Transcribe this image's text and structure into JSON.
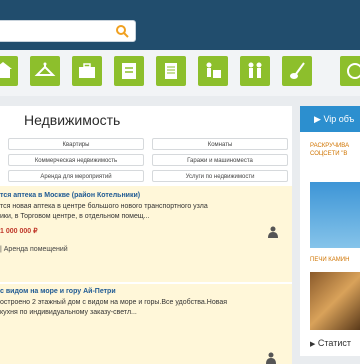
{
  "search": {
    "value": "",
    "placeholder": ""
  },
  "categories": [
    "real-estate",
    "clothing",
    "jobs",
    "services",
    "documents",
    "moving",
    "kids",
    "music",
    "hobbies"
  ],
  "main": {
    "title": "Недвижимость",
    "subcategories": [
      "Квартиры",
      "Комнаты",
      "Коммерческая недвижимость",
      "Гаражи и машиноместа",
      "Аренда для мероприятий",
      "Услуги по недвижимости"
    ],
    "listings": [
      {
        "title": "тся аптека в Москве (район Котельники)",
        "desc_line1": "тся новая аптека в центре большого нового транспортного узла",
        "desc_line2": "ики, в Торговом центре, в отдельном помещ...",
        "price": "1 000 000 ₽",
        "category": "| Аренда помещений"
      },
      {
        "title": "с видом на море и гору Ай-Петри",
        "desc_line1": "остроено 2 этажный дом с видом на море и горы.Все удобства.Новая",
        "desc_line2": "кухня по индивидуальному заказу-светл..."
      }
    ]
  },
  "sidebar": {
    "vip_label": "Vip объ",
    "ad1_line1": "РАСКРУЧИВА",
    "ad1_line2": "СОЦСЕТИ \"В",
    "ad2_title": "ПЕЧИ КАМИН",
    "stats_label": "Статист"
  }
}
